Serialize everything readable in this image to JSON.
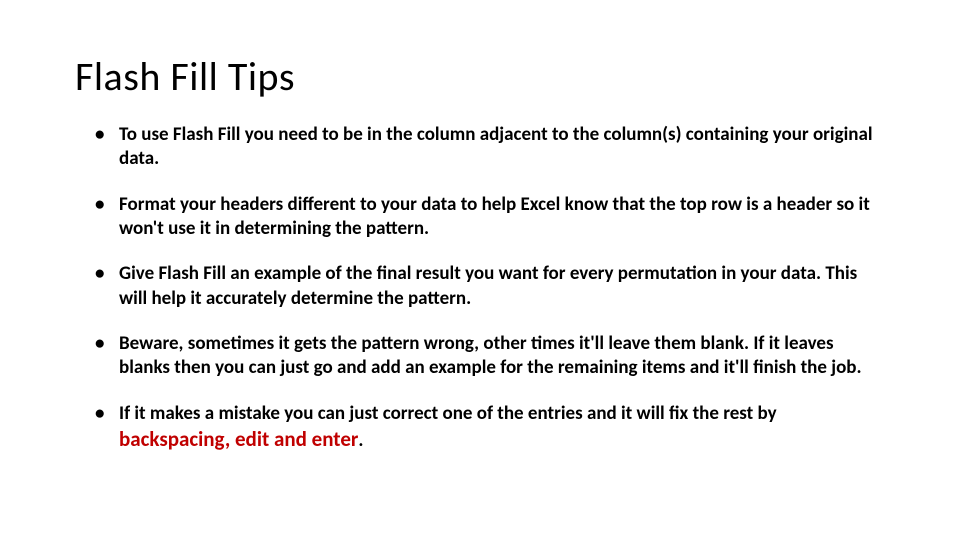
{
  "title": "Flash Fill Tips",
  "bullets": [
    "To use Flash Fill you need to be in the column adjacent to the column(s) containing your original data.",
    "Format your headers different to your data to help Excel know that the top row is a header so it won't use it in determining the pattern.",
    "Give Flash Fill an example of the final result you want for every permutation in your data. This will help it accurately determine the pattern.",
    "Beware, sometimes it gets the pattern wrong, other times it'll leave them blank. If it leaves blanks then you can just go and add an example for the remaining items and it'll finish the job."
  ],
  "last_bullet": {
    "prefix": "If it makes a mistake you can just correct one of the entries and it will fix the rest by ",
    "highlight": "backspacing, edit and enter",
    "suffix": "."
  }
}
